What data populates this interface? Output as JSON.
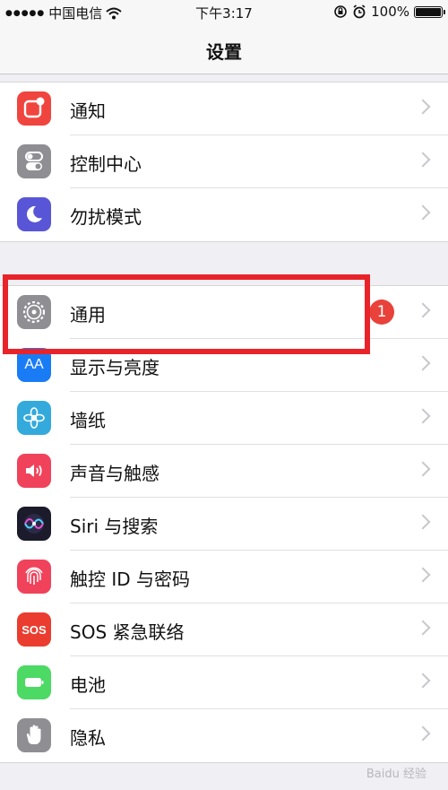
{
  "status_bar": {
    "carrier": "中国电信",
    "time": "下午3:17",
    "battery_percent": "100%",
    "wifi_icon": "wifi-icon",
    "lock_icon": "rotation-lock-icon",
    "alarm_icon": "alarm-icon"
  },
  "nav": {
    "title": "设置"
  },
  "groups": [
    {
      "items": [
        {
          "label": "通知",
          "icon": "notifications-icon",
          "color": "#f0453e"
        },
        {
          "label": "控制中心",
          "icon": "control-center-icon",
          "color": "#8e8e93"
        },
        {
          "label": "勿扰模式",
          "icon": "moon-icon",
          "color": "#5856d6"
        }
      ]
    },
    {
      "items": [
        {
          "label": "通用",
          "icon": "gear-icon",
          "color": "#8e8e93",
          "badge": "1"
        },
        {
          "label": "显示与亮度",
          "icon": "display-brightness-icon",
          "color": "#1a7cf5"
        },
        {
          "label": "墙纸",
          "icon": "wallpaper-icon",
          "color": "#34aadc"
        },
        {
          "label": "声音与触感",
          "icon": "speaker-icon",
          "color": "#f0435b"
        },
        {
          "label": "Siri 与搜索",
          "icon": "siri-icon",
          "color": "#1b1b2b"
        },
        {
          "label": "触控 ID 与密码",
          "icon": "fingerprint-icon",
          "color": "#f0435b"
        },
        {
          "label": "SOS 紧急联络",
          "icon": "sos-icon",
          "color": "#ea3d2f"
        },
        {
          "label": "电池",
          "icon": "battery-icon",
          "color": "#4cd964"
        },
        {
          "label": "隐私",
          "icon": "hand-icon",
          "color": "#8e8e93"
        }
      ]
    }
  ],
  "icon_text": {
    "display": "AA",
    "sos": "SOS"
  },
  "watermark": "Baidu 经验"
}
